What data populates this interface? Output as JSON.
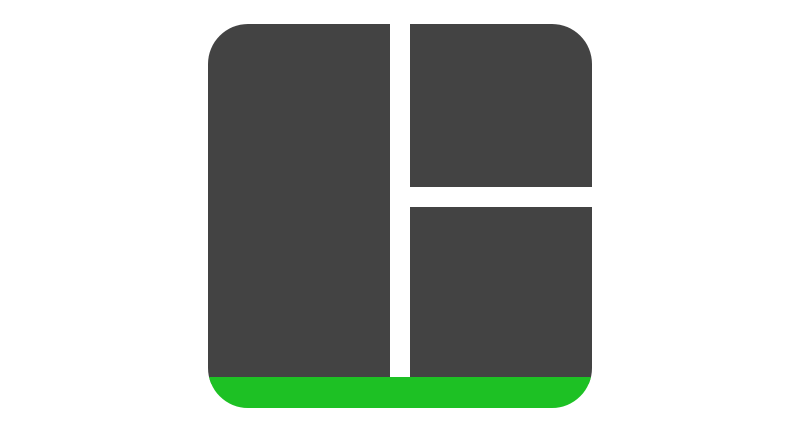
{
  "logo": {
    "icon_name": "split-layout-icon",
    "panel_color": "#434343",
    "accent_bar_color": "#1dc124",
    "background_color": "#ffffff"
  }
}
